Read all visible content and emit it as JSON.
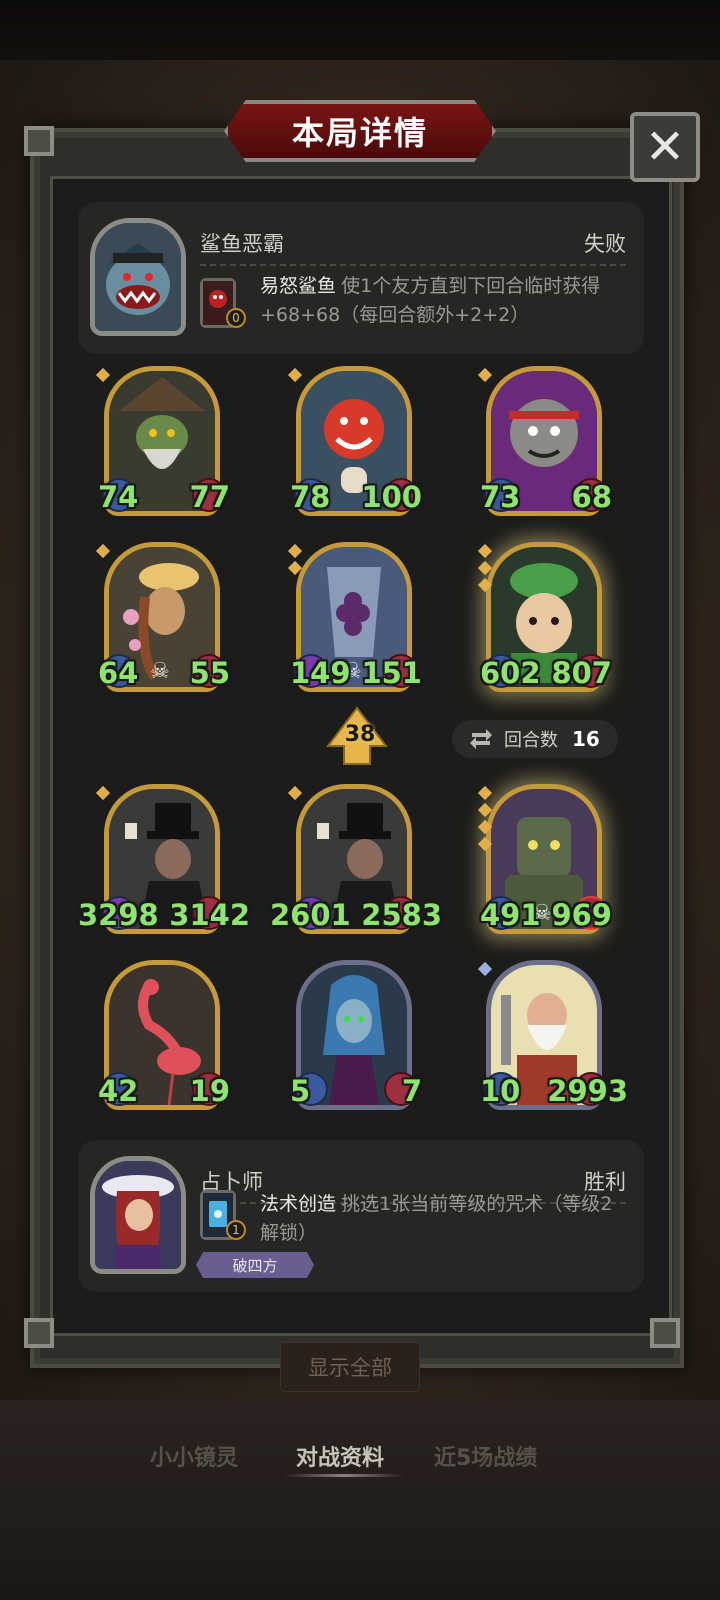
{
  "dialog": {
    "title": "本局详情",
    "close_symbol": "✕"
  },
  "opponent": {
    "name": "鲨鱼恶霸",
    "result": "失败",
    "skill_name": "易怒鲨鱼",
    "skill_desc": "使1个友方直到下回合临时获得+68+68（每回合额外+2+2）",
    "skill_cost": "0"
  },
  "player": {
    "name": "占卜师",
    "result": "胜利",
    "skill_name": "法术创造",
    "skill_desc": "挑选1张当前等级的咒术（等级2解锁）",
    "skill_cost": "1",
    "tag": "破四方"
  },
  "opponent_minions": [
    {
      "atk": "74",
      "hp": "77",
      "skull": false,
      "pips": 1
    },
    {
      "atk": "78",
      "hp": "100",
      "skull": false,
      "pips": 1
    },
    {
      "atk": "73",
      "hp": "68",
      "skull": false,
      "pips": 1
    },
    {
      "atk": "64",
      "hp": "55",
      "skull": true,
      "pips": 1
    },
    {
      "atk": "149",
      "hp": "151",
      "skull": true,
      "pips": 2
    },
    {
      "atk": "602",
      "hp": "807",
      "skull": false,
      "pips": 3
    }
  ],
  "player_minions": [
    {
      "atk": "3298",
      "hp": "3142",
      "skull": false,
      "pips": 1
    },
    {
      "atk": "2601",
      "hp": "2583",
      "skull": false,
      "pips": 1
    },
    {
      "atk": "491",
      "hp": "969",
      "skull": true,
      "pips": 4
    },
    {
      "atk": "42",
      "hp": "19",
      "skull": false,
      "pips": 0
    },
    {
      "atk": "5",
      "hp": "7",
      "skull": false,
      "pips": 0
    },
    {
      "atk": "10",
      "hp": "2993",
      "skull": false,
      "pips": 1
    }
  ],
  "tier": "38",
  "turns": {
    "label": "回合数",
    "value": "16"
  },
  "show_all": "显示全部",
  "tabs": [
    "小小镜灵",
    "对战资料",
    "近5场战绩"
  ],
  "active_tab": 1
}
